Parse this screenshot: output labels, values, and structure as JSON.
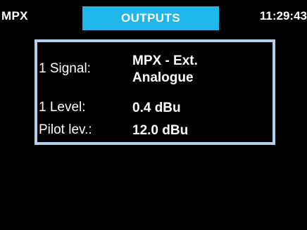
{
  "header": {
    "mode": "MPX",
    "screen_title": "OUTPUTS",
    "time": "11:29:43"
  },
  "panel": {
    "rows": [
      {
        "label": "1 Signal:",
        "value_line1": "MPX - Ext.",
        "value_line2": "Analogue"
      },
      {
        "label": "1 Level:",
        "value": "0.4 dBu"
      },
      {
        "label": "Pilot lev.:",
        "value": "12.0 dBu"
      }
    ]
  },
  "colors": {
    "background": "#000000",
    "tab_accent": "#1fb6ec",
    "panel_border": "#b3d2ef",
    "text": "#ffffff"
  }
}
